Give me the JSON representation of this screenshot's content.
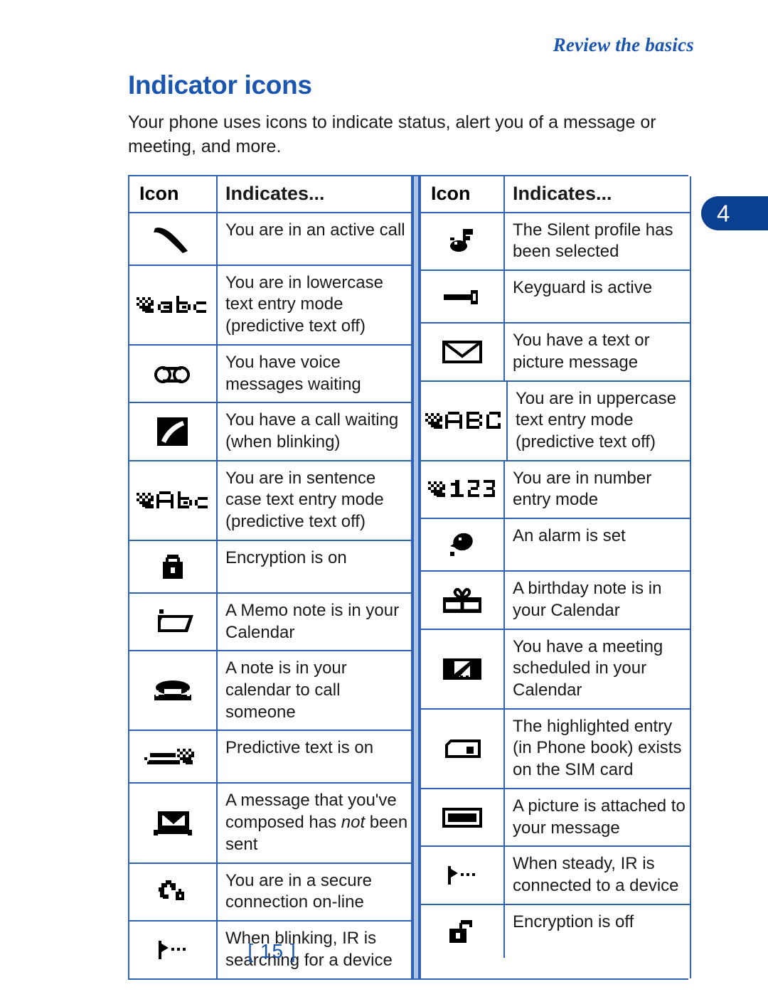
{
  "header": {
    "running_title": "Review the basics",
    "chapter_number": "4"
  },
  "page": {
    "title": "Indicator icons",
    "intro": "Your phone uses icons to indicate status, alert you of a message or meeting, and more.",
    "folio": "[ 15 ]"
  },
  "table": {
    "columns": {
      "icon_header": "Icon",
      "indicates_header": "Indicates..."
    },
    "left_rows": [
      {
        "icon": "active-call-handset-icon",
        "text": "You are in an active call"
      },
      {
        "icon": "lowercase-abc-predictive-off-icon",
        "text": "You are in lowercase text entry mode (predictive text off)"
      },
      {
        "icon": "voice-mail-tape-icon",
        "text": "You have voice messages waiting"
      },
      {
        "icon": "call-waiting-inverted-handset-icon",
        "text": "You have a call waiting (when blinking)"
      },
      {
        "icon": "sentence-case-abc-predictive-off-icon",
        "text": "You are in sentence case text entry mode (predictive text off)"
      },
      {
        "icon": "encryption-on-closed-padlock-icon",
        "text": "Encryption is on"
      },
      {
        "icon": "memo-note-icon",
        "text": "A Memo note is in your Calendar"
      },
      {
        "icon": "call-note-telephone-icon",
        "text": "A note is in your calendar to call someone"
      },
      {
        "icon": "predictive-text-on-icon",
        "text": "Predictive text is on"
      },
      {
        "icon": "unsent-message-outbox-icon",
        "text_before": "A message that you've composed has ",
        "text_italic": "not",
        "text_after": " been sent"
      },
      {
        "icon": "secure-connection-handset-lock-icon",
        "text": "You are in a secure connection on-line"
      },
      {
        "icon": "infrared-searching-icon",
        "text": "When blinking, IR is searching for a device"
      }
    ],
    "right_rows": [
      {
        "icon": "silent-profile-muted-note-icon",
        "text": "The Silent profile has been selected"
      },
      {
        "icon": "keyguard-key-icon",
        "text": "Keyguard is active"
      },
      {
        "icon": "text-picture-message-envelope-icon",
        "text": "You have a text or picture message"
      },
      {
        "icon": "uppercase-abc-predictive-off-icon",
        "text": "You are in uppercase text entry mode (predictive text off)"
      },
      {
        "icon": "number-entry-123-icon",
        "text": "You are in number entry mode"
      },
      {
        "icon": "alarm-bell-icon",
        "text": "An alarm is set"
      },
      {
        "icon": "birthday-gift-icon",
        "text": "A birthday note is in your Calendar"
      },
      {
        "icon": "meeting-handshake-icon",
        "text": "You have a meeting scheduled in your Calendar"
      },
      {
        "icon": "sim-card-entry-icon",
        "text": "The highlighted entry (in Phone book) exists on the SIM card"
      },
      {
        "icon": "picture-attached-icon",
        "text": "A picture is attached to your message"
      },
      {
        "icon": "infrared-connected-icon",
        "text": "When steady, IR is connected to a device"
      },
      {
        "icon": "encryption-off-open-padlock-icon",
        "text": "Encryption is off"
      }
    ]
  },
  "colors": {
    "heading_blue": "#1a56b0",
    "tab_blue": "#0b3f8f",
    "rule_blue": "#2f62b5",
    "separator_blue": "#aec4e6"
  }
}
